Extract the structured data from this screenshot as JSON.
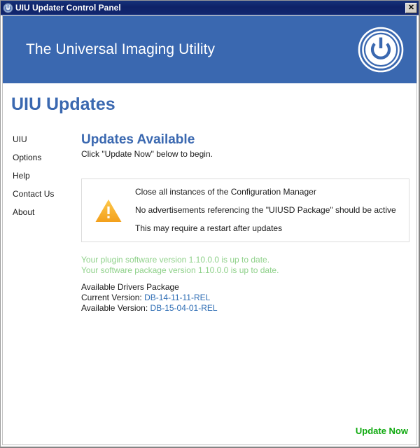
{
  "window": {
    "title": "UIU Updater Control Panel",
    "app_icon": "power-icon",
    "close_label": "✕"
  },
  "banner": {
    "title": "The Universal Imaging Utility",
    "logo": "power-button-logo",
    "background_color": "#3a68b0"
  },
  "page": {
    "title": "UIU Updates"
  },
  "sidebar": {
    "items": [
      {
        "label": "UIU"
      },
      {
        "label": "Options"
      },
      {
        "label": "Help"
      },
      {
        "label": "Contact Us"
      },
      {
        "label": "About"
      }
    ]
  },
  "main": {
    "heading": "Updates Available",
    "subtitle": "Click \"Update Now\" below to begin.",
    "warning": {
      "icon": "warning-triangle-icon",
      "icon_color": "#f5a623",
      "lines": [
        "Close all instances of the Configuration Manager",
        "No advertisements referencing the \"UIUSD Package\" should be active",
        "This may require a restart after updates"
      ]
    },
    "status": {
      "color": "#8fd18a",
      "lines": [
        "Your plugin software version 1.10.0.0 is up to date.",
        "Your software package version 1.10.0.0 is up to date."
      ]
    },
    "drivers": {
      "title": "Available Drivers Package",
      "current_label": "Current Version:",
      "current_value": "DB-14-11-11-REL",
      "available_label": "Available Version:",
      "available_value": "DB-15-04-01-REL",
      "value_color": "#2e6db4"
    }
  },
  "footer": {
    "update_label": "Update Now",
    "update_color": "#11aa11"
  }
}
